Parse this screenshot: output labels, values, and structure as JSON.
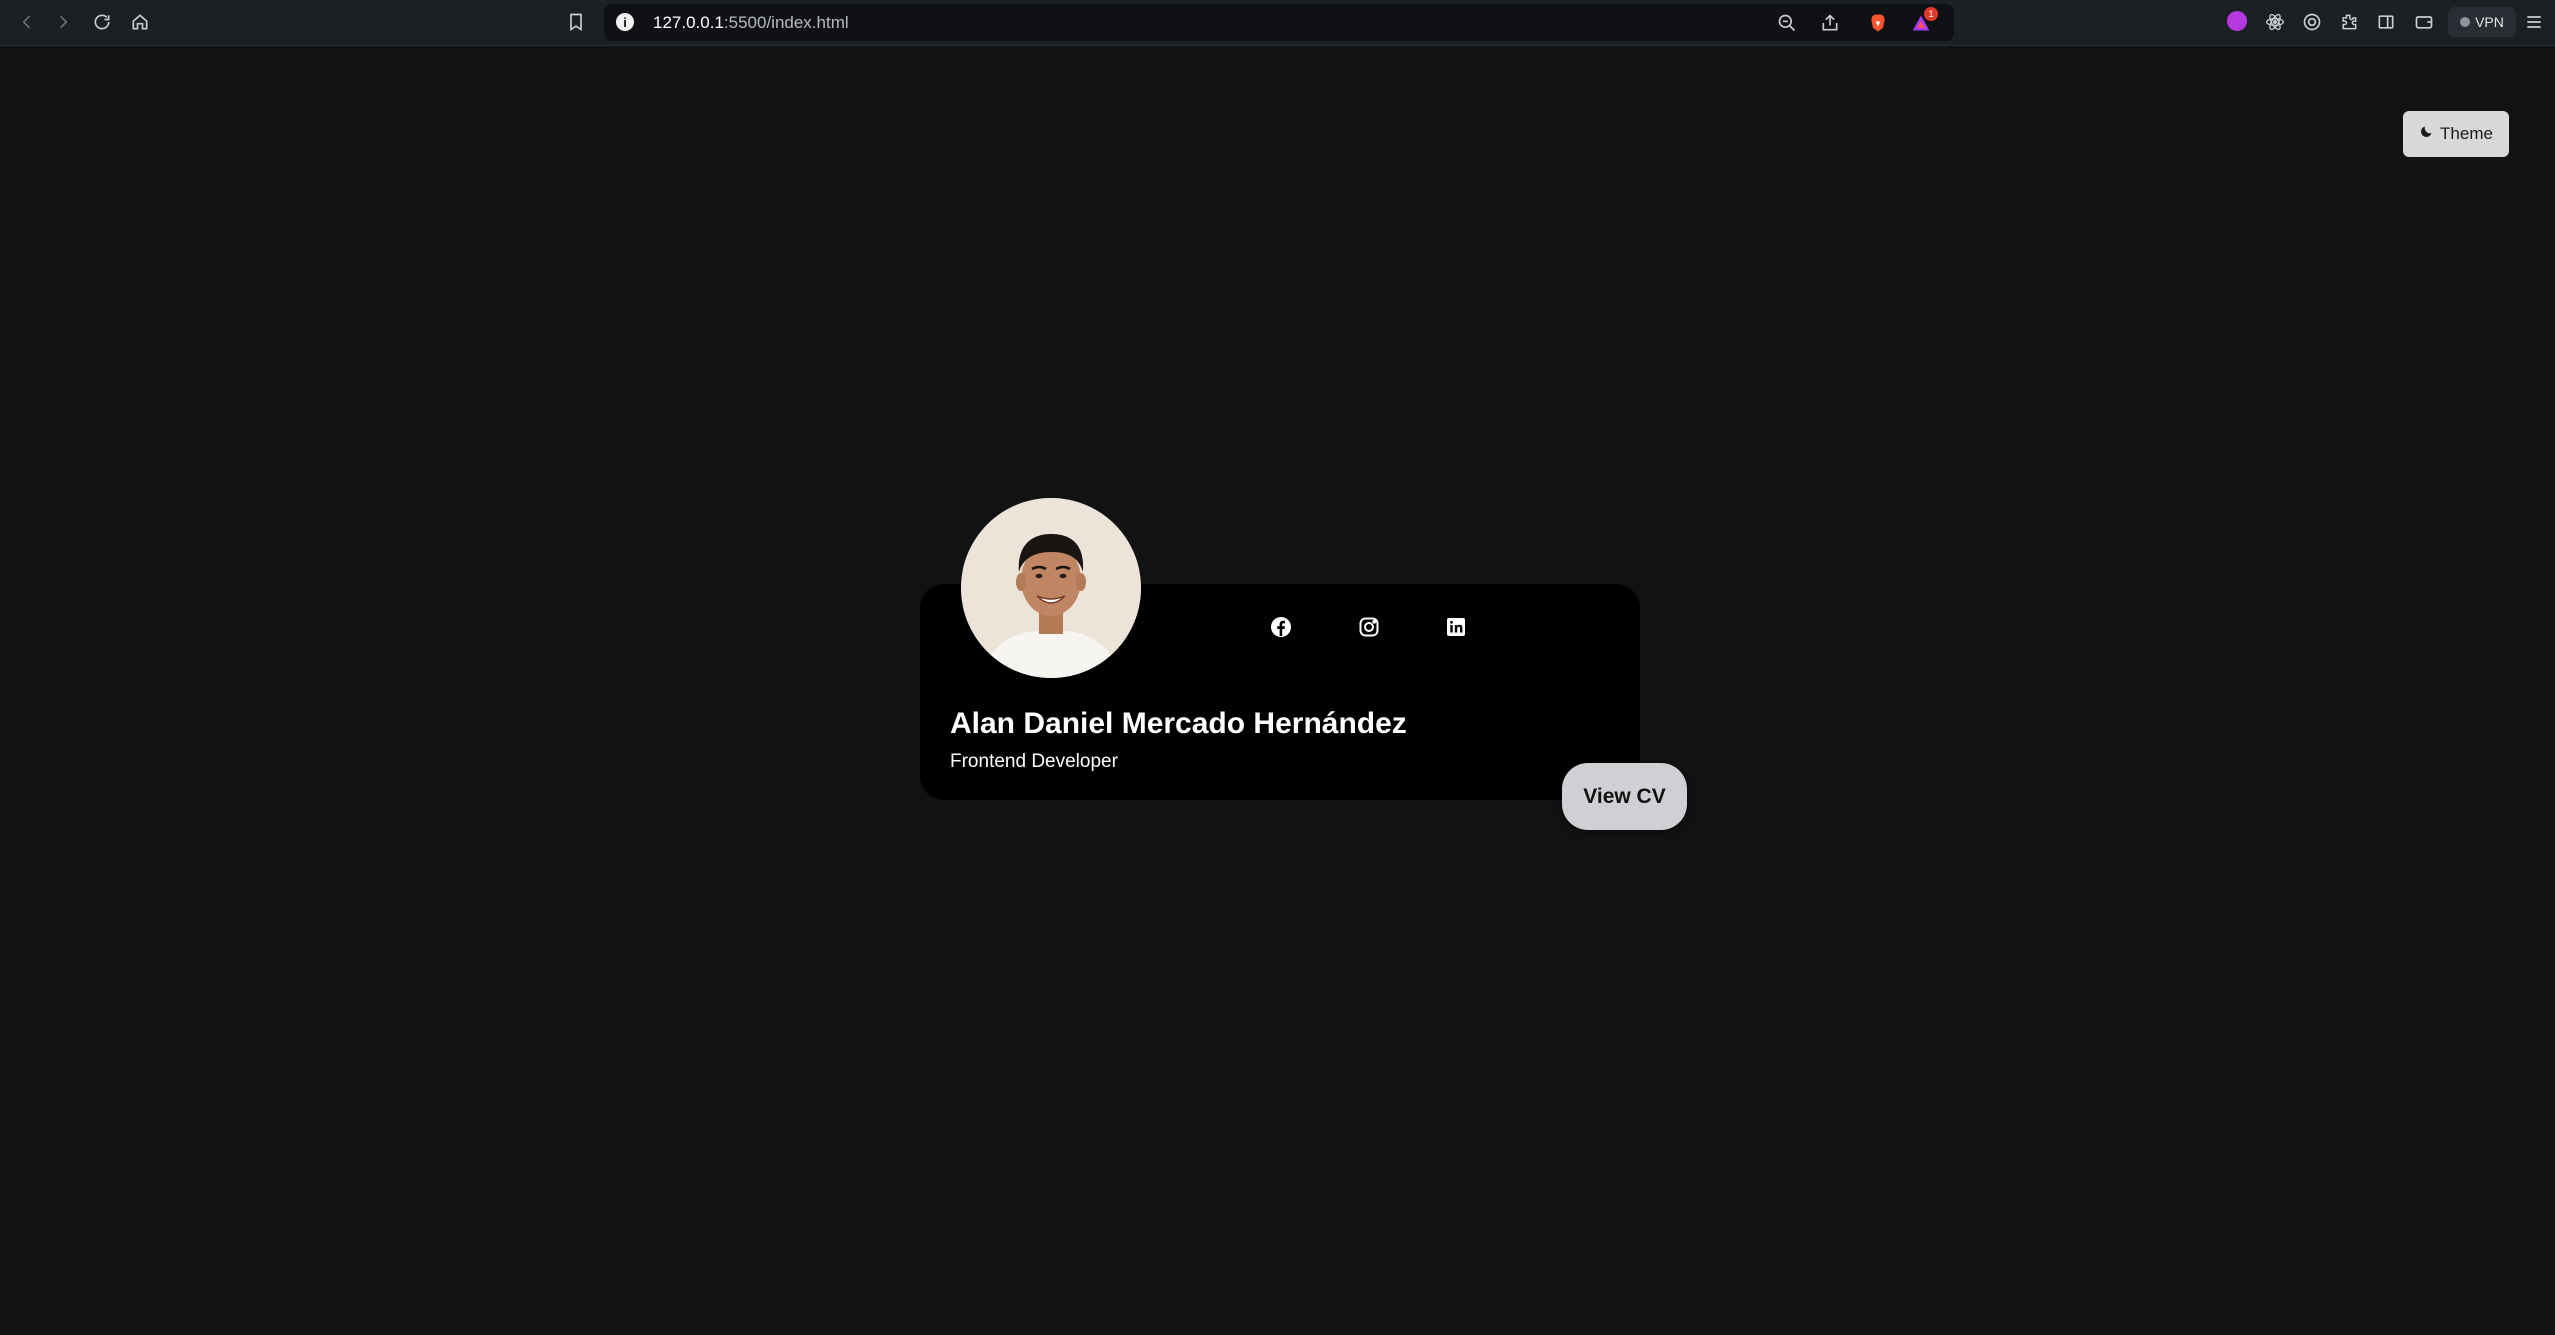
{
  "browser": {
    "url_host": "127.0.0.1",
    "url_path": ":5500/index.html",
    "rewards_badge": "1",
    "vpn_label": "VPN"
  },
  "page": {
    "theme_button_label": "Theme",
    "profile": {
      "name": "Alan Daniel Mercado Hernández",
      "role": "Frontend Developer"
    },
    "social_links": [
      {
        "icon": "facebook-icon"
      },
      {
        "icon": "instagram-icon"
      },
      {
        "icon": "linkedin-icon"
      }
    ],
    "cv_button_label": "View CV"
  },
  "colors": {
    "page_background": "#121212",
    "card_background": "#000000",
    "button_background": "#d0d0d4",
    "text_primary": "#ffffff"
  }
}
